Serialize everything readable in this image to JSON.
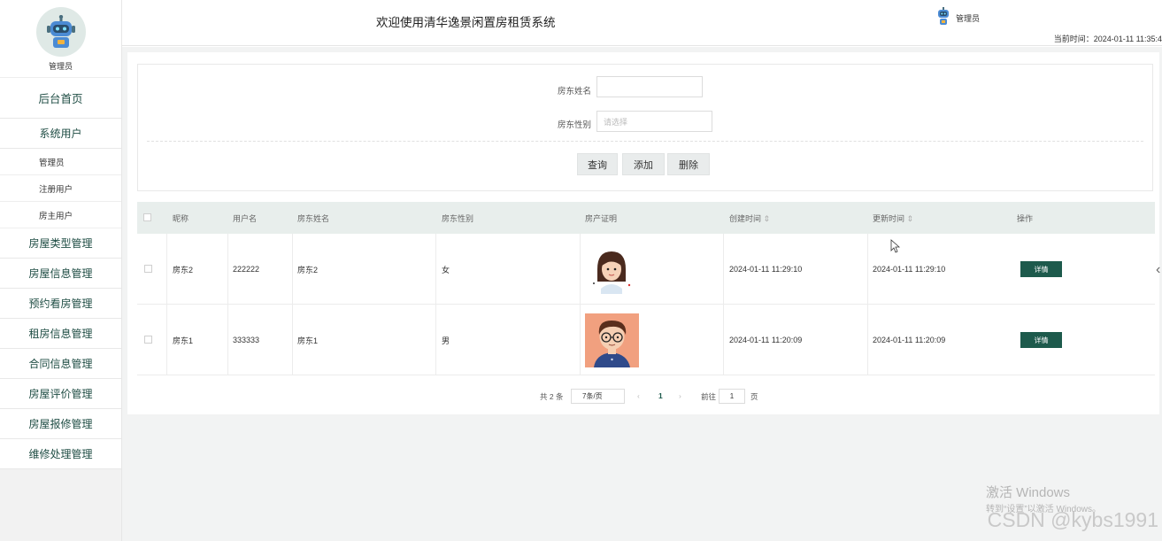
{
  "sidebar": {
    "profile_name": "管理员",
    "home": "后台首页",
    "system_users": "系统用户",
    "sub_items": [
      "管理员",
      "注册用户",
      "房主用户"
    ],
    "menu": [
      "房屋类型管理",
      "房屋信息管理",
      "预约看房管理",
      "租房信息管理",
      "合同信息管理",
      "房屋评价管理",
      "房屋报修管理",
      "维修处理管理"
    ]
  },
  "header": {
    "title": "欢迎使用清华逸景闲置房租赁系统",
    "user": "管理员",
    "time": "当前时间：2024-01-11 11:35:4"
  },
  "search": {
    "name_label": "房东姓名",
    "name_value": "",
    "gender_label": "房东性别",
    "gender_placeholder": "请选择",
    "query_btn": "查询",
    "add_btn": "添加",
    "delete_btn": "删除"
  },
  "table": {
    "headers": [
      "昵称",
      "用户名",
      "房东姓名",
      "房东性别",
      "房产证明",
      "创建时间",
      "更新时间",
      "操作"
    ],
    "rows": [
      {
        "nickname": "房东2",
        "username": "222222",
        "name": "房东2",
        "gender": "女",
        "created": "2024-01-11 11:29:10",
        "updated": "2024-01-11 11:29:10",
        "action": "详情"
      },
      {
        "nickname": "房东1",
        "username": "333333",
        "name": "房东1",
        "gender": "男",
        "created": "2024-01-11 11:20:09",
        "updated": "2024-01-11 11:20:09",
        "action": "详情"
      }
    ],
    "sort_icon": "sort-icon"
  },
  "pagination": {
    "total": "共 2 条",
    "page_size": "7条/页",
    "current": "1",
    "goto_label": "前往",
    "goto_value": "1",
    "page_unit": "页"
  },
  "watermark": {
    "line1": "激活 Windows",
    "line2": "转到“设置”以激活 Windows。",
    "csdn": "CSDN @kybs1991"
  },
  "colors": {
    "accent": "#1d5a4c",
    "table_header": "#e8eeec"
  }
}
